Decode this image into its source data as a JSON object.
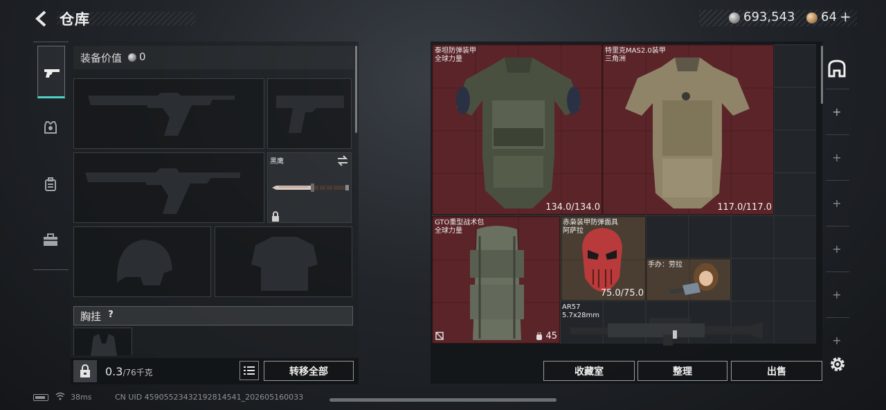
{
  "header": {
    "title": "仓库",
    "money": "693,543",
    "tickets": "64",
    "plus": "+"
  },
  "left_panel": {
    "equip_value_label": "装备价值",
    "equip_value": "0",
    "melee_name": "黑鹰",
    "chest_rig_label": "胸挂",
    "help": "?",
    "weight": "0.3",
    "weight_cap": "/76千克",
    "transfer_all": "转移全部"
  },
  "stash_items": [
    {
      "name": "泰坦防弹装甲",
      "sub": "全球力量",
      "durability": "134.0/134.0"
    },
    {
      "name": "特里克MAS2.0装甲",
      "sub": "三角洲",
      "durability": "117.0/117.0"
    },
    {
      "name": "GTO重型战术包",
      "sub": "全球力量",
      "count": "45"
    },
    {
      "name": "赤枭装甲防弹面具",
      "sub": "阿萨拉",
      "durability": "75.0/75.0"
    },
    {
      "name": "手办：劳拉"
    },
    {
      "name": "AR57",
      "sub": "5.7x28mm"
    }
  ],
  "bottom_buttons": {
    "collection": "收藏室",
    "sort": "整理",
    "sell": "出售"
  },
  "status": {
    "ping": "38ms",
    "uid": "CN UID 4590552343219281​4541_202605160033"
  },
  "colors": {
    "accent_teal": "#4fd3c3",
    "item_red": "#5a2428",
    "item_brown": "#4a3e33"
  },
  "icons": [
    "back-arrow-icon",
    "silver-coin-icon",
    "gold-coin-icon",
    "pistol-icon",
    "armor-icon",
    "backpack-icon",
    "toolbox-icon",
    "lock-icon",
    "list-icon",
    "swap-icon",
    "no-insure-icon",
    "bag-icon",
    "stash-icon",
    "gear-icon",
    "battery-icon",
    "wifi-icon"
  ]
}
